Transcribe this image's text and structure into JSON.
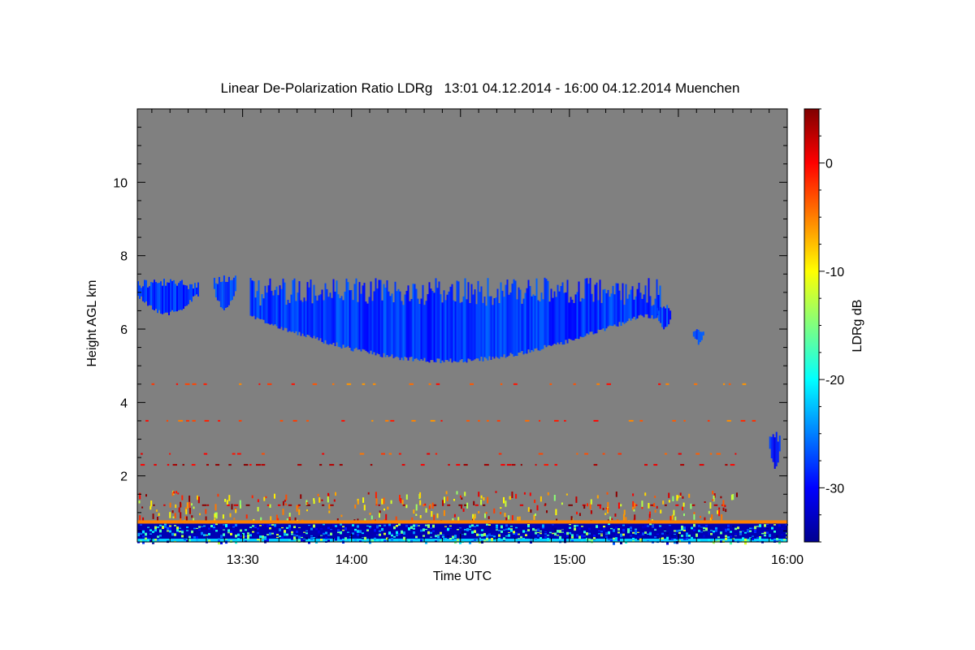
{
  "chart_data": {
    "type": "heatmap",
    "title": "Linear De-Polarization Ratio LDRg   13:01 04.12.2014 - 16:00 04.12.2014 Muenchen",
    "xlabel": "Time UTC",
    "ylabel": "Height AGL km",
    "colorbar_label": "LDRg dB",
    "x_range_minutes_utc": [
      781,
      960
    ],
    "x_ticks": [
      {
        "minute": 810,
        "label": "13:30"
      },
      {
        "minute": 840,
        "label": "14:00"
      },
      {
        "minute": 870,
        "label": "14:30"
      },
      {
        "minute": 900,
        "label": "15:00"
      },
      {
        "minute": 930,
        "label": "15:30"
      },
      {
        "minute": 960,
        "label": "16:00"
      }
    ],
    "y_range_km": [
      0.2,
      12
    ],
    "y_ticks": [
      {
        "value": 2,
        "label": "2"
      },
      {
        "value": 4,
        "label": "4"
      },
      {
        "value": 6,
        "label": "6"
      },
      {
        "value": 8,
        "label": "8"
      },
      {
        "value": 10,
        "label": "10"
      }
    ],
    "colorbar_range_db": [
      -35,
      5
    ],
    "colorbar_ticks": [
      {
        "value": 0,
        "label": "0"
      },
      {
        "value": -10,
        "label": "-10"
      },
      {
        "value": -20,
        "label": "-20"
      },
      {
        "value": -30,
        "label": "-30"
      }
    ],
    "colormap": "jet",
    "no_signal_color": "#808080",
    "features": [
      {
        "kind": "cloud",
        "t_start_min": 781,
        "t_end_min": 798,
        "h_bottom_km": 6.5,
        "h_top_km": 7.4,
        "ldr_db": -28
      },
      {
        "kind": "cloud",
        "t_start_min": 802,
        "t_end_min": 808,
        "h_bottom_km": 6.6,
        "h_top_km": 7.5,
        "ldr_db": -28
      },
      {
        "kind": "cloud",
        "t_start_min": 812,
        "t_end_min": 925,
        "h_bottom_km": 5.2,
        "h_top_km": 7.4,
        "ldr_db": -28
      },
      {
        "kind": "cloud",
        "t_start_min": 924,
        "t_end_min": 928,
        "h_bottom_km": 6.1,
        "h_top_km": 6.7,
        "ldr_db": -28
      },
      {
        "kind": "cloud",
        "t_start_min": 934,
        "t_end_min": 937,
        "h_bottom_km": 5.7,
        "h_top_km": 6.0,
        "ldr_db": -27
      },
      {
        "kind": "cloud",
        "t_start_min": 955,
        "t_end_min": 958,
        "h_bottom_km": 2.3,
        "h_top_km": 3.2,
        "ldr_db": -29
      },
      {
        "kind": "noise_line",
        "h_km": 4.5,
        "ldr_db": -3
      },
      {
        "kind": "noise_line",
        "h_km": 3.5,
        "ldr_db": -3
      },
      {
        "kind": "noise_line",
        "h_km": 2.6,
        "ldr_db": -2
      },
      {
        "kind": "noise_line",
        "h_km": 2.3,
        "ldr_db": 2
      },
      {
        "kind": "noise_line",
        "h_km": 1.2,
        "ldr_db": 3
      },
      {
        "kind": "noise_zone",
        "h_bottom_km": 0.6,
        "h_top_km": 1.6,
        "ldr_db_range": [
          -15,
          5
        ]
      },
      {
        "kind": "surface_layer",
        "h_bottom_km": 0.2,
        "h_top_km": 0.7,
        "ldr_db_range": [
          -35,
          -5
        ]
      }
    ]
  }
}
